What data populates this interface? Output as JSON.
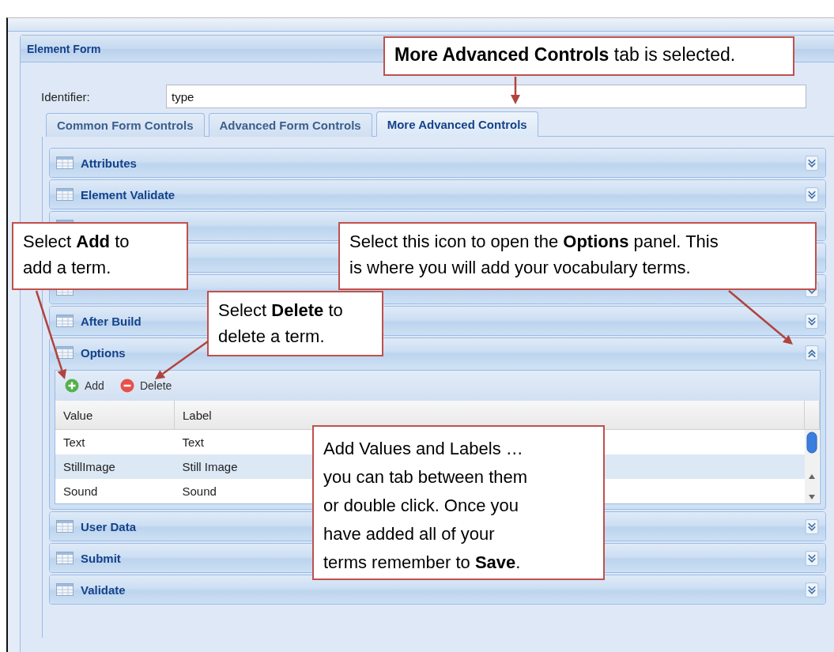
{
  "window": {
    "title": "Element Form"
  },
  "identifier": {
    "label": "Identifier:",
    "value": "type"
  },
  "tabs": [
    {
      "label": "Common Form Controls",
      "selected": false
    },
    {
      "label": "Advanced Form Controls",
      "selected": false
    },
    {
      "label": "More Advanced Controls",
      "selected": true
    }
  ],
  "sections": [
    {
      "kind": "panel",
      "title": "Attributes",
      "expanded": false
    },
    {
      "kind": "panel",
      "title": "Element Validate",
      "expanded": false
    },
    {
      "kind": "covered"
    },
    {
      "kind": "covered"
    },
    {
      "kind": "panel",
      "expanded": false
    },
    {
      "kind": "panel",
      "title": "After Build",
      "expanded": false
    },
    {
      "kind": "panel",
      "title": "Options",
      "expanded": true,
      "toolbar": [
        {
          "kind": "add",
          "label": "Add"
        },
        {
          "kind": "delete",
          "label": "Delete"
        }
      ],
      "grid": {
        "columns": [
          "Value",
          "Label"
        ],
        "rows": [
          [
            "Text",
            "Text"
          ],
          [
            "StillImage",
            "Still Image"
          ],
          [
            "Sound",
            "Sound"
          ]
        ]
      }
    },
    {
      "kind": "panel",
      "title": "User Data",
      "expanded": false
    },
    {
      "kind": "panel",
      "title": "Submit",
      "expanded": false
    },
    {
      "kind": "panel",
      "title": "Validate",
      "expanded": false
    }
  ],
  "callouts": [
    {
      "lines": [
        "**More Advanced Controls** tab is selected."
      ]
    },
    {
      "lines": [
        "Select **Add** to",
        "add a term."
      ]
    },
    {
      "lines": [
        "Select this icon to open the **Options** panel. This",
        "is where you will add your vocabulary terms."
      ]
    },
    {
      "lines": [
        "Select **Delete** to",
        "delete a term."
      ]
    },
    {
      "lines": [
        "Add Values and Labels …",
        "you can tab between them",
        "or double click.  Once you",
        "have added all of your",
        "terms remember to **Save**."
      ]
    }
  ]
}
